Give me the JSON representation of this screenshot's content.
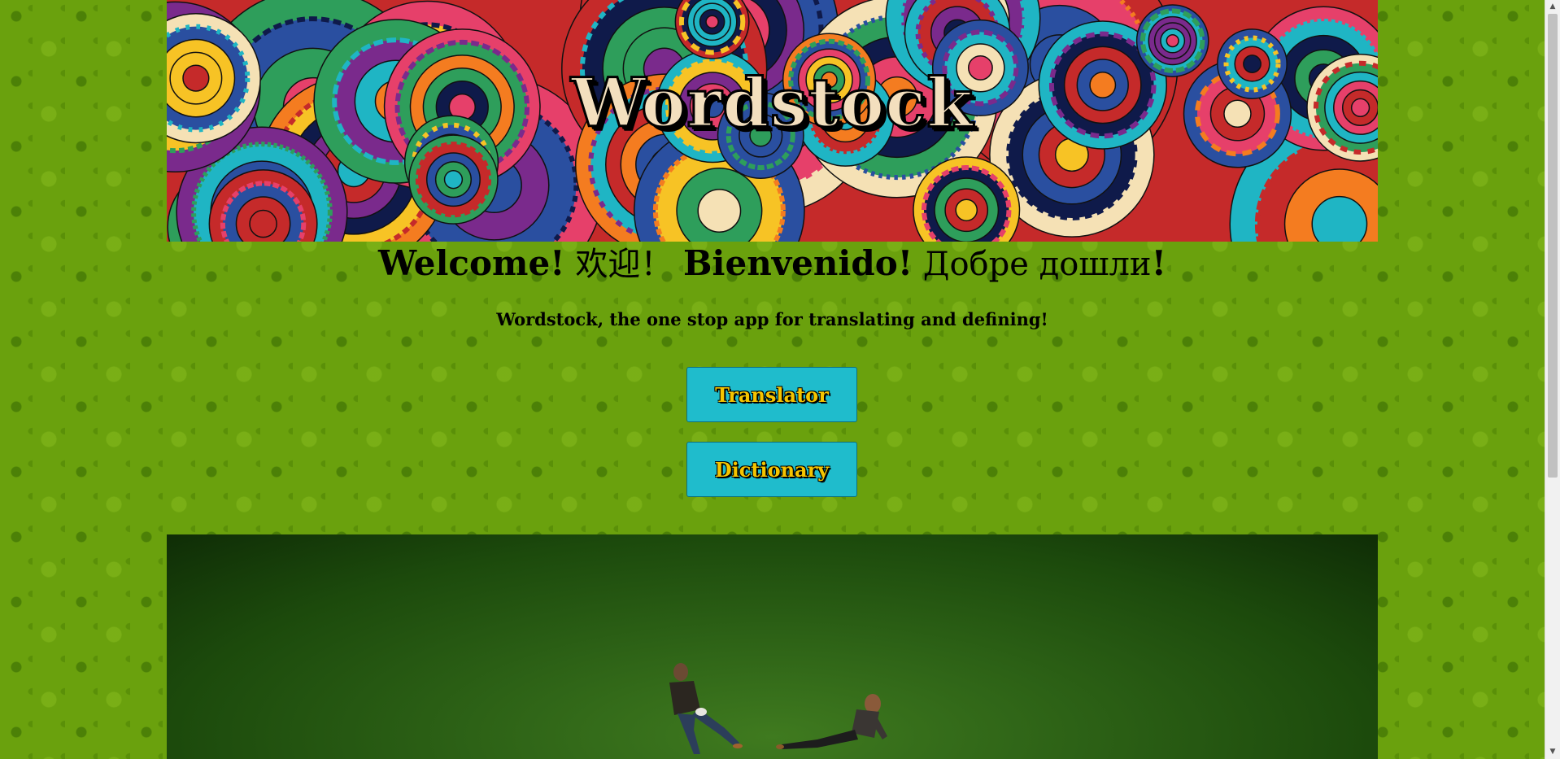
{
  "banner": {
    "title": "Wordstock",
    "colors": [
      "#c52a2a",
      "#f47c20",
      "#f7c325",
      "#1fb5c4",
      "#2a4fa0",
      "#7a2a8c",
      "#e6406a",
      "#2e9e5b",
      "#f5e1b5",
      "#0f1a4a"
    ]
  },
  "welcome": {
    "part1": "Welcome!",
    "part2": " 欢迎！ ",
    "part3": "Bienvenido!",
    "part4": " Добре дошли",
    "part5": "!"
  },
  "tagline": "Wordstock, the one stop app for translating and defining!",
  "buttons": {
    "translator": "Translator",
    "dictionary": "Dictionary"
  },
  "theme": {
    "background": "#6aa10d",
    "button_bg": "#1fbccc",
    "button_text": "#f5c400"
  },
  "scrollbar": {
    "up_icon": "triangle-up",
    "down_icon": "triangle-down"
  }
}
